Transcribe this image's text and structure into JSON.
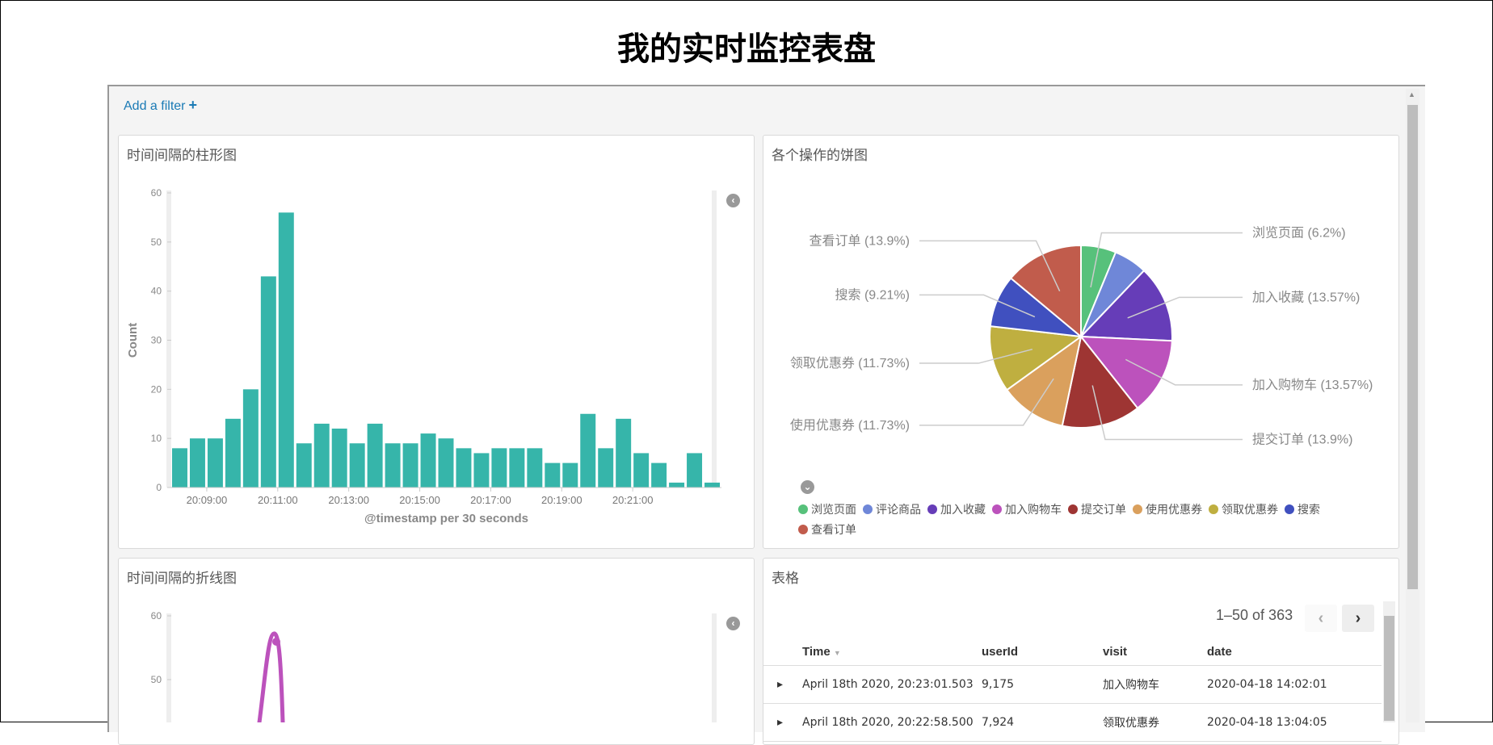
{
  "page": {
    "title": "我的实时监控表盘"
  },
  "filter_bar": {
    "add_filter_label": "Add a filter",
    "plus_icon": "+"
  },
  "panels": {
    "bar": {
      "title": "时间间隔的柱形图",
      "x_axis_label": "@timestamp per 30 seconds",
      "y_axis_label": "Count"
    },
    "pie": {
      "title": "各个操作的饼图"
    },
    "line": {
      "title": "时间间隔的折线图"
    },
    "table": {
      "title": "表格"
    }
  },
  "chart_data": [
    {
      "type": "bar",
      "xlabel": "@timestamp per 30 seconds",
      "ylabel": "Count",
      "ylim": [
        0,
        60
      ],
      "y_ticks": [
        "0",
        "10",
        "20",
        "30",
        "40",
        "50",
        "60"
      ],
      "x_tick_labels": [
        "20:09:00",
        "20:11:00",
        "20:13:00",
        "20:15:00",
        "20:17:00",
        "20:19:00",
        "20:21:00"
      ],
      "values": [
        8,
        10,
        10,
        14,
        20,
        43,
        56,
        9,
        13,
        12,
        9,
        13,
        9,
        9,
        11,
        10,
        8,
        7,
        8,
        8,
        8,
        5,
        5,
        15,
        8,
        14,
        7,
        5,
        1,
        7,
        1
      ],
      "color": "#36b5aa"
    },
    {
      "type": "pie",
      "slices": [
        {
          "label": "浏览页面 (6.2%)",
          "name": "浏览页面",
          "value": 6.2,
          "color": "#57c17b"
        },
        {
          "label": "评论商品",
          "name": "评论商品",
          "value": 5.9,
          "color": "#6f87d8"
        },
        {
          "label": "加入收藏 (13.57%)",
          "name": "加入收藏",
          "value": 13.57,
          "color": "#663db8"
        },
        {
          "label": "加入购物车 (13.57%)",
          "name": "加入购物车",
          "value": 13.57,
          "color": "#bc52bc"
        },
        {
          "label": "提交订单 (13.9%)",
          "name": "提交订单",
          "value": 13.9,
          "color": "#9e3533"
        },
        {
          "label": "使用优惠券 (11.73%)",
          "name": "使用优惠券",
          "value": 11.73,
          "color": "#daa05d"
        },
        {
          "label": "领取优惠券 (11.73%)",
          "name": "领取优惠券",
          "value": 11.73,
          "color": "#bfaf40"
        },
        {
          "label": "搜索 (9.21%)",
          "name": "搜索",
          "value": 9.21,
          "color": "#4050bf"
        },
        {
          "label": "查看订单 (13.9%)",
          "name": "查看订单",
          "value": 13.9,
          "color": "#c15c4c"
        }
      ]
    },
    {
      "type": "line",
      "ylim": [
        0,
        60
      ],
      "y_ticks": [
        "50",
        "60"
      ],
      "color": "#bc52bc"
    }
  ],
  "table": {
    "pagination": "1–50 of 363",
    "prev_icon": "‹",
    "next_icon": "›",
    "columns": [
      "Time",
      "userId",
      "visit",
      "date"
    ],
    "rows": [
      {
        "time": "April 18th 2020, 20:23:01.503",
        "userId": "9,175",
        "visit": "加入购物车",
        "date": "2020-04-18 14:02:01"
      },
      {
        "time": "April 18th 2020, 20:22:58.500",
        "userId": "7,924",
        "visit": "领取优惠券",
        "date": "2020-04-18 13:04:05"
      }
    ]
  }
}
